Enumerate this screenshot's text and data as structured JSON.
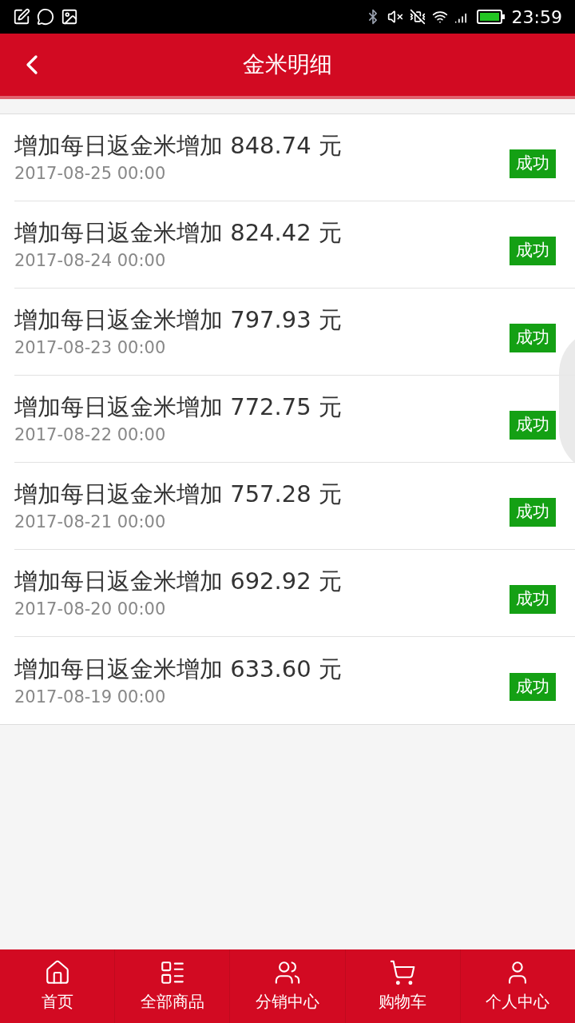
{
  "status_bar": {
    "time": "23:59"
  },
  "header": {
    "title": "金米明细"
  },
  "records": [
    {
      "title": "增加每日返金米增加 848.74 元",
      "date": "2017-08-25 00:00",
      "status": "成功"
    },
    {
      "title": "增加每日返金米增加 824.42 元",
      "date": "2017-08-24 00:00",
      "status": "成功"
    },
    {
      "title": "增加每日返金米增加 797.93 元",
      "date": "2017-08-23 00:00",
      "status": "成功"
    },
    {
      "title": "增加每日返金米增加 772.75 元",
      "date": "2017-08-22 00:00",
      "status": "成功"
    },
    {
      "title": "增加每日返金米增加 757.28 元",
      "date": "2017-08-21 00:00",
      "status": "成功"
    },
    {
      "title": "增加每日返金米增加 692.92 元",
      "date": "2017-08-20 00:00",
      "status": "成功"
    },
    {
      "title": "增加每日返金米增加 633.60 元",
      "date": "2017-08-19 00:00",
      "status": "成功"
    }
  ],
  "bottom_nav": [
    {
      "label": "首页",
      "kind": "home"
    },
    {
      "label": "全部商品",
      "kind": "catalog"
    },
    {
      "label": "分销中心",
      "kind": "distribution"
    },
    {
      "label": "购物车",
      "kind": "cart"
    },
    {
      "label": "个人中心",
      "kind": "profile"
    }
  ]
}
